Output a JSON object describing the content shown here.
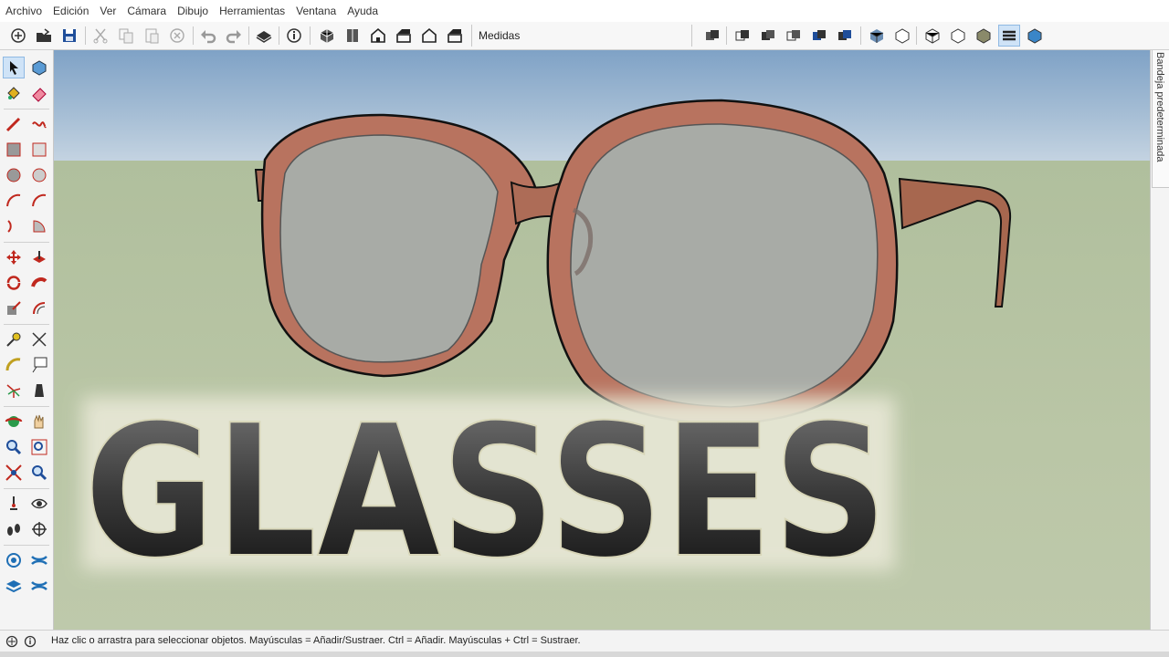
{
  "menu": [
    "Archivo",
    "Edición",
    "Ver",
    "Cámara",
    "Dibujo",
    "Herramientas",
    "Ventana",
    "Ayuda"
  ],
  "toolbar": {
    "measurements_label": "Medidas",
    "left_icons": [
      "new-icon",
      "open-icon",
      "save-icon",
      "cut-icon",
      "copy-icon",
      "paste-icon",
      "erase-icon",
      "undo-icon",
      "redo-icon",
      "print-icon",
      "model-info-icon"
    ],
    "view_icons": [
      "iso-view-icon",
      "top-view-icon",
      "front-view-icon",
      "right-view-icon",
      "back-view-icon",
      "left-view-icon"
    ],
    "style_icons": [
      "xray-icon",
      "back-edges-icon",
      "wireframe-icon",
      "hidden-line-icon",
      "shaded-icon",
      "shaded-textures-icon",
      "monochrome-icon",
      "section-plane-icon",
      "section-display-icon",
      "section-cut-icon",
      "section-fill-icon",
      "layer-icon",
      "component-icon"
    ]
  },
  "palette_icons": [
    "select-icon",
    "component-make-icon",
    "paint-bucket-icon",
    "eraser-icon",
    "line-icon",
    "freehand-icon",
    "rectangle-icon",
    "rotated-rectangle-icon",
    "circle-icon",
    "polygon-icon",
    "arc-icon",
    "two-point-arc-icon",
    "three-point-arc-icon",
    "pie-icon",
    "move-icon",
    "push-pull-icon",
    "rotate-icon",
    "follow-me-icon",
    "scale-icon",
    "offset-icon",
    "tape-measure-icon",
    "dimension-icon",
    "protractor-icon",
    "text-icon",
    "axes-icon",
    "3d-text-icon",
    "orbit-icon",
    "pan-icon",
    "zoom-icon",
    "zoom-window-icon",
    "zoom-extents-icon",
    "previous-view-icon",
    "position-camera-icon",
    "look-around-icon",
    "walk-icon",
    "section-plane-tool-icon",
    "sandbox-icon",
    "sandbox-from-scratch-icon",
    "stamp-icon",
    "drape-icon"
  ],
  "viewport": {
    "model_text": "GLASSES",
    "frame_color": "#b8735f",
    "lens_color": "#a8aba6"
  },
  "tray": {
    "label": "Bandeja predeterminada"
  },
  "status": {
    "text": "Haz clic o arrastra para seleccionar objetos. Mayúsculas = Añadir/Sustraer. Ctrl = Añadir. Mayúsculas + Ctrl = Sustraer."
  }
}
